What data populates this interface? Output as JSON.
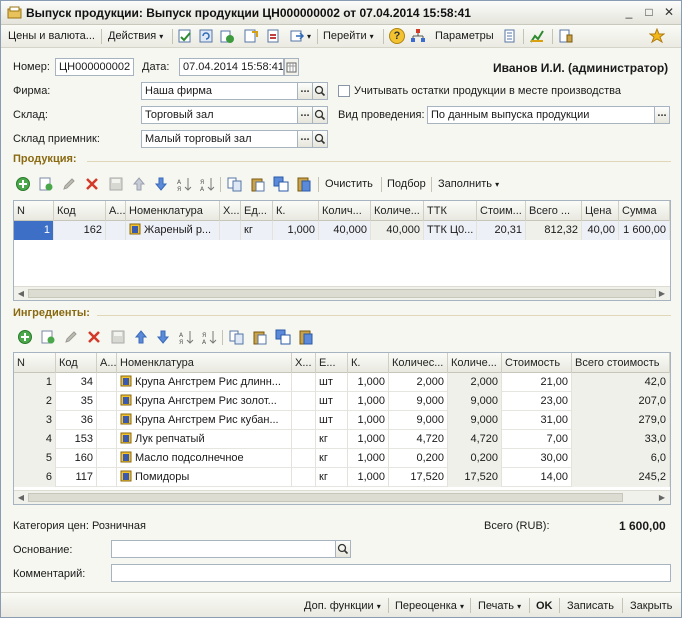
{
  "window": {
    "title": "Выпуск продукции: Выпуск продукции ЦН000000002 от 07.04.2014 15:58:41",
    "minimize": "_",
    "maximize": "□",
    "close": "✕"
  },
  "toolbar": {
    "prices_label": "Цены и валюта...",
    "actions_label": "Действия",
    "goto_label": "Перейти",
    "help_label": "?",
    "params_label": "Параметры",
    "dropdown_arrow": "▾"
  },
  "header": {
    "number_label": "Номер:",
    "number_value": "ЦН000000002",
    "date_label": "Дата:",
    "date_value": "07.04.2014 15:58:41",
    "user": "Иванов И.И. (администратор)",
    "firm_label": "Фирма:",
    "firm_value": "Наша фирма",
    "warehouse_label": "Склад:",
    "warehouse_value": "Торговый зал",
    "receiver_label": "Склад приемник:",
    "receiver_value": "Малый торговый зал",
    "account_remaining_label": "Учитывать остатки продукции в месте производства",
    "posting_type_label": "Вид проведения:",
    "posting_type_value": "По данным выпуска продукции",
    "dots": "...",
    "checked": false
  },
  "products": {
    "section_title": "Продукция:",
    "clear_label": "Очистить",
    "select_label": "Подбор",
    "fill_label": "Заполнить",
    "columns": [
      "N",
      "Код",
      "А...",
      "Номенклатура",
      "Х...",
      "Ед...",
      "К.",
      "Колич...",
      "Количе...",
      "ТТК",
      "Стоим...",
      "Всего ...",
      "Цена",
      "Сумма"
    ],
    "rows": [
      {
        "n": "1",
        "code": "162",
        "a": "",
        "name": "Жареный р...",
        "x": "",
        "unit": "кг",
        "k": "1,000",
        "qty1": "40,000",
        "qty2": "40,000",
        "ttk": "ТТК Ц0...",
        "cost": "20,31",
        "total": "812,32",
        "price": "40,00",
        "sum": "1 600,00"
      }
    ]
  },
  "ingredients": {
    "section_title": "Ингредиенты:",
    "columns": [
      "N",
      "Код",
      "А...",
      "Номенклатура",
      "Х...",
      "Е...",
      "К.",
      "Количес...",
      "Количе...",
      "Стоимость",
      "Всего стоимость"
    ],
    "rows": [
      {
        "n": "1",
        "code": "34",
        "a": "",
        "name": "Крупа Ангстрем Рис длинн...",
        "x": "",
        "unit": "шт",
        "k": "1,000",
        "qty1": "2,000",
        "qty2": "2,000",
        "cost": "21,00",
        "total": "42,0"
      },
      {
        "n": "2",
        "code": "35",
        "a": "",
        "name": "Крупа Ангстрем Рис золот...",
        "x": "",
        "unit": "шт",
        "k": "1,000",
        "qty1": "9,000",
        "qty2": "9,000",
        "cost": "23,00",
        "total": "207,0"
      },
      {
        "n": "3",
        "code": "36",
        "a": "",
        "name": "Крупа Ангстрем Рис кубан...",
        "x": "",
        "unit": "шт",
        "k": "1,000",
        "qty1": "9,000",
        "qty2": "9,000",
        "cost": "31,00",
        "total": "279,0"
      },
      {
        "n": "4",
        "code": "153",
        "a": "",
        "name": "Лук репчатый",
        "x": "",
        "unit": "кг",
        "k": "1,000",
        "qty1": "4,720",
        "qty2": "4,720",
        "cost": "7,00",
        "total": "33,0"
      },
      {
        "n": "5",
        "code": "160",
        "a": "",
        "name": "Масло подсолнечное",
        "x": "",
        "unit": "кг",
        "k": "1,000",
        "qty1": "0,200",
        "qty2": "0,200",
        "cost": "30,00",
        "total": "6,0"
      },
      {
        "n": "6",
        "code": "117",
        "a": "",
        "name": "Помидоры",
        "x": "",
        "unit": "кг",
        "k": "1,000",
        "qty1": "17,520",
        "qty2": "17,520",
        "cost": "14,00",
        "total": "245,2"
      }
    ]
  },
  "footer": {
    "price_category": "Категория цен: Розничная",
    "total_label": "Всего (RUB):",
    "total_value": "1 600,00",
    "basis_label": "Основание:",
    "basis_value": "",
    "comment_label": "Комментарий:",
    "comment_value": ""
  },
  "bottombar": {
    "extra_label": "Доп. функции",
    "reprice_label": "Переоценка",
    "print_label": "Печать",
    "ok_label": "OK",
    "save_label": "Записать",
    "close_label": "Закрыть"
  },
  "colors": {
    "section_title": "#8a6a10",
    "selected_row": "#3d6fc7",
    "border": "#a8b3c2"
  }
}
